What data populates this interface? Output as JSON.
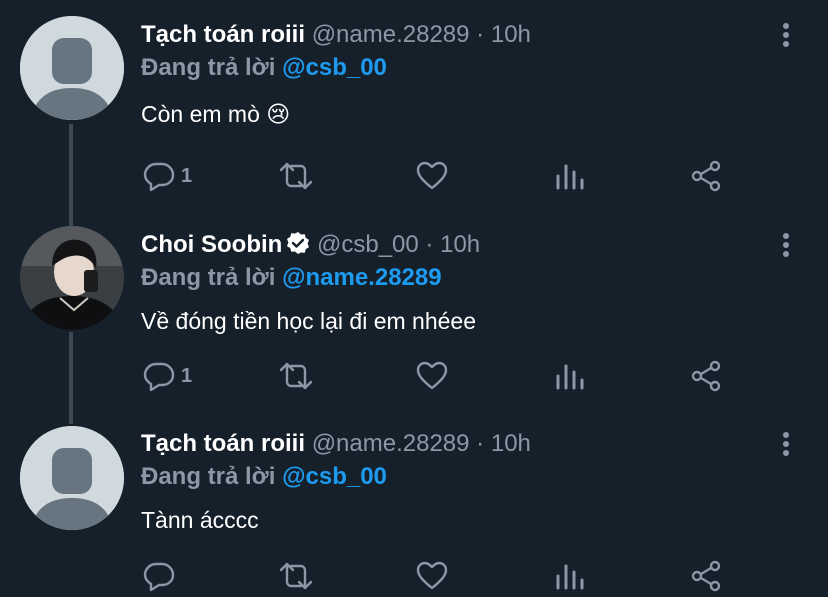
{
  "tweets": [
    {
      "name": "Tạch toán roiii",
      "handle": "@name.28289",
      "separator": "·",
      "time": "10h",
      "replying_label": "Đang trả lời",
      "replying_to": "@csb_00",
      "text": "Còn em mò 😢",
      "reply_count": "1",
      "avatar": "default-avatar"
    },
    {
      "name": "Choi Soobin",
      "verified": true,
      "handle": "@csb_00",
      "separator": "·",
      "time": "10h",
      "replying_label": "Đang trả lời",
      "replying_to": "@name.28289",
      "text": "Về đóng tiền học lại đi em nhéee",
      "reply_count": "1",
      "avatar": "profile-photo"
    },
    {
      "name": "Tạch toán roiii",
      "handle": "@name.28289",
      "separator": "·",
      "time": "10h",
      "replying_label": "Đang trả lời",
      "replying_to": "@csb_00",
      "text": "Tànn ácccc",
      "reply_count": "",
      "avatar": "default-avatar"
    }
  ],
  "icons": {
    "reply": "reply-icon",
    "retweet": "retweet-icon",
    "like": "like-icon",
    "analytics": "analytics-icon",
    "share": "share-icon",
    "more": "more-icon",
    "verified": "verified-badge-icon"
  },
  "colors": {
    "background": "#15202b",
    "mention": "#1d9bf0",
    "secondary_text": "#8b98a5",
    "thread_line": "#3d4a56"
  }
}
